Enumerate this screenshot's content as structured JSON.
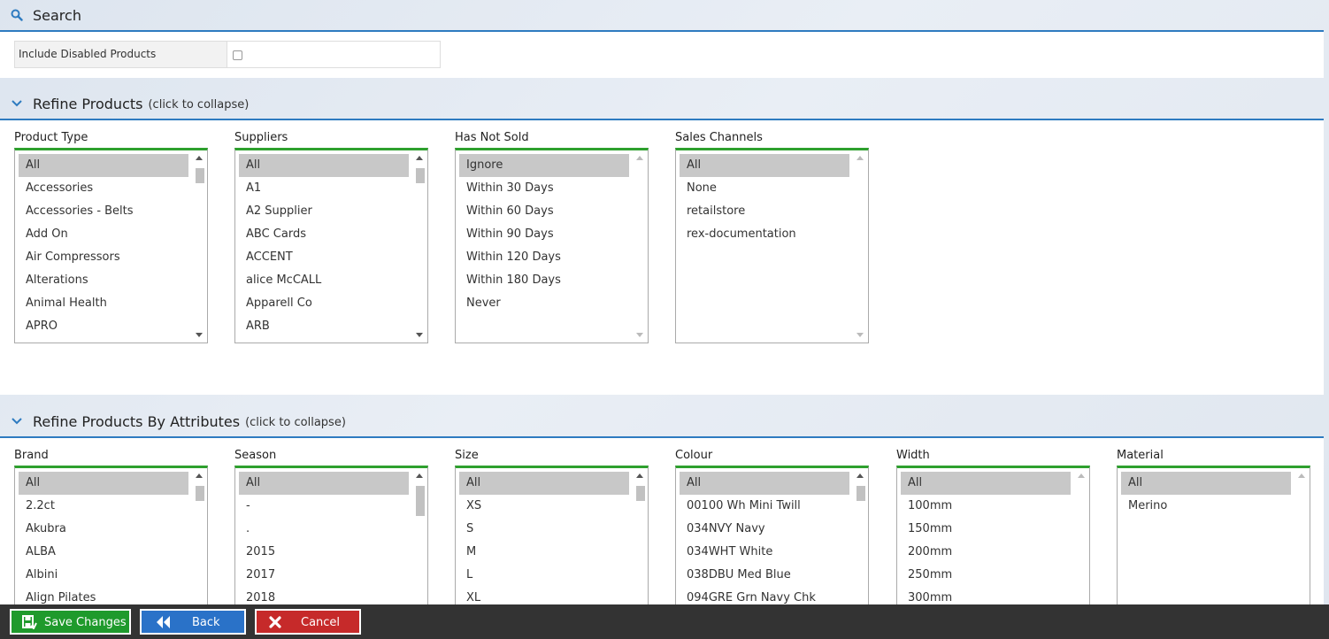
{
  "search_section": {
    "title": "Search"
  },
  "include_disabled": {
    "label": "Include Disabled Products",
    "checked": false
  },
  "refine_products": {
    "title": "Refine Products",
    "hint": "(click to collapse)",
    "columns": [
      {
        "label": "Product Type",
        "options": [
          "All",
          "Accessories",
          "Accessories - Belts",
          "Add On",
          "Air Compressors",
          "Alterations",
          "Animal Health",
          "APRO"
        ]
      },
      {
        "label": "Suppliers",
        "options": [
          "All",
          "A1",
          "A2 Supplier",
          "ABC Cards",
          "ACCENT",
          "alice McCALL",
          "Apparell Co",
          "ARB"
        ]
      },
      {
        "label": "Has Not Sold",
        "options": [
          "Ignore",
          "Within 30 Days",
          "Within 60 Days",
          "Within 90 Days",
          "Within 120 Days",
          "Within 180 Days",
          "Never"
        ]
      },
      {
        "label": "Sales Channels",
        "options": [
          "All",
          "None",
          "retailstore",
          "rex-documentation"
        ]
      }
    ]
  },
  "refine_attributes": {
    "title": "Refine Products By Attributes",
    "hint": "(click to collapse)",
    "columns": [
      {
        "label": "Brand",
        "options": [
          "All",
          "2.2ct",
          "Akubra",
          "ALBA",
          "Albini",
          "Align Pilates"
        ]
      },
      {
        "label": "Season",
        "options": [
          "All",
          "-",
          ".",
          "2015",
          "2017",
          "2018"
        ]
      },
      {
        "label": "Size",
        "options": [
          "All",
          "XS",
          "S",
          "M",
          "L",
          "XL"
        ]
      },
      {
        "label": "Colour",
        "options": [
          "All",
          "00100 Wh Mini Twill",
          "034NVY Navy",
          "034WHT White",
          "038DBU Med Blue",
          "094GRE Grn Navy Chk"
        ]
      },
      {
        "label": "Width",
        "options": [
          "All",
          "100mm",
          "150mm",
          "200mm",
          "250mm",
          "300mm"
        ]
      },
      {
        "label": "Material",
        "options": [
          "All",
          "Merino"
        ]
      }
    ]
  },
  "actions": {
    "save": "Save Changes",
    "back": "Back",
    "cancel": "Cancel"
  },
  "colors": {
    "accent_blue": "#2e7bc0",
    "list_top_green": "#2ea02e",
    "save_green": "#1f9a2c",
    "back_blue": "#2a72c8",
    "cancel_red": "#c62a2a",
    "bar_dark": "#333333"
  }
}
